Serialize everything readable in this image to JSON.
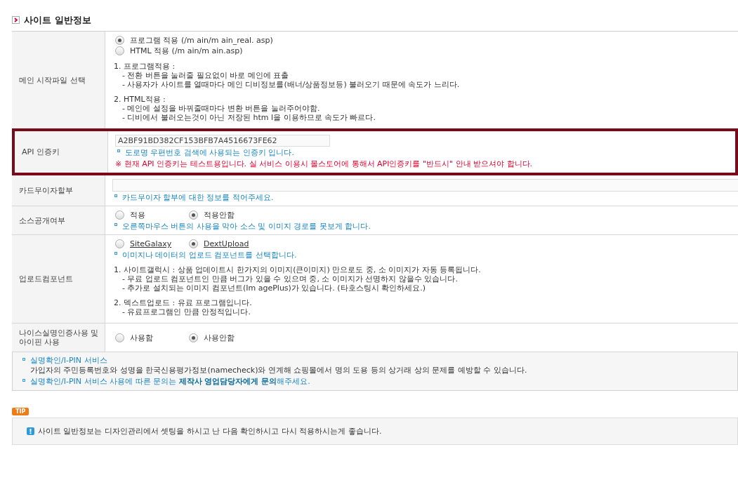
{
  "section_title": "사이트 일반정보",
  "rows": [
    {
      "label": "메인 시작파일 선택",
      "radios": [
        {
          "label": "프로그램 적용 (/m ain/m ain_real. asp)",
          "selected": true
        },
        {
          "label": "HTML 적용 (/m ain/m ain.asp)",
          "selected": false
        }
      ],
      "notes": [
        {
          "heading": "1. 프로그램적용 :",
          "lines": [
            "- 전환 버튼을 눌러줄 필요없이 바로 메인에 표출",
            "- 사용자가 사이트를 열때마다 메인 디비정보를(배너/상품정보등) 불러오기 때문에 속도가 느리다."
          ]
        },
        {
          "heading": "2. HTML적용 :",
          "lines": [
            "- 메인에 설정을 바꿔줄때마다 변환 버튼을 눌러주어야함.",
            "- 디비에서 불러오는것이 아닌 저장된 htm l을 이용하므로 속도가 빠르다."
          ]
        }
      ]
    },
    {
      "label": "API 인증키",
      "highlighted": true,
      "field": {
        "value": "A2BF91BD382CF153BFB7A4516673FE62"
      },
      "hint": "도로명 우편번호 검색에 사용되는 인증키 입니다.",
      "warning": "※ 현재 API 인증키는 테스트용입니다. 실 서비스 이용시 몰스토어에 통해서 API인증키를 \"반드시\" 안내 받으셔야 합니다."
    },
    {
      "label": "카드무이자할부",
      "field": {},
      "hint": "카드무이자 할부에 대한 정보를 적어주세요."
    },
    {
      "label": "소스공개여부",
      "radios": [
        {
          "label": "적용",
          "selected": false
        },
        {
          "label": "적용안함",
          "selected": true
        }
      ],
      "hint": "오른쪽마우스 버튼의 사용을 막아 소스 및 이미지 경로를 못보게 합니다."
    },
    {
      "label": "업로드컴포넌트",
      "radios": [
        {
          "label": "SiteGalaxy",
          "selected": false,
          "underlined": true
        },
        {
          "label": "DextUpload",
          "selected": true,
          "underlined": true
        }
      ],
      "hint": "이미지나 데이터의 업로드 컴포넌트를 선택합니다.",
      "notes": [
        {
          "heading": "1. 사이트갤럭시 : 상품 업데이트시 한가지의 이미지(큰이미지) 만으로도 중, 소 이미지가 자동 등록됩니다.",
          "lines": [
            "- 무료 업로드 컴포넌트인 만큼 버그가 있을 수 있으며 중, 소 이미지가 선명하지 않을수 있습니다.",
            "- 추가로 설치되는 이미지 컴포넌트(Im agePlus)가 있습니다. (타호스팅시 확인하세요.)"
          ]
        },
        {
          "heading": "2. 덱스트업로드 : 유료 프로그램입니다.",
          "lines": [
            "- 유료프로그램인 만큼 안정적입니다."
          ]
        }
      ]
    },
    {
      "label": "나이스실명인증사용 및 아이핀 사용",
      "radios": [
        {
          "label": "사용함",
          "selected": false
        },
        {
          "label": "사용안함",
          "selected": true
        }
      ]
    }
  ],
  "info": [
    {
      "title": "실명확인/I-PIN 서비스",
      "text": "가입자의 주민등록번호와 성명을 한국신용평가정보(namecheck)와 연계해 쇼핑몰에서 명의 도용 등의 상거래 상의 문제를 예방할 수 있습니다."
    },
    {
      "title": "실명확인/I-PIN 서비스 사용에 따른 문의는 **제작사 영업담당자에게 문의**해주세요."
    }
  ],
  "tip": {
    "badge": "TIP",
    "text": "사이트 일반정보는 디자인관리에서 셋팅을 하시고 난 다음 확인하시고 다시 적용하시는게 좋습니다."
  }
}
